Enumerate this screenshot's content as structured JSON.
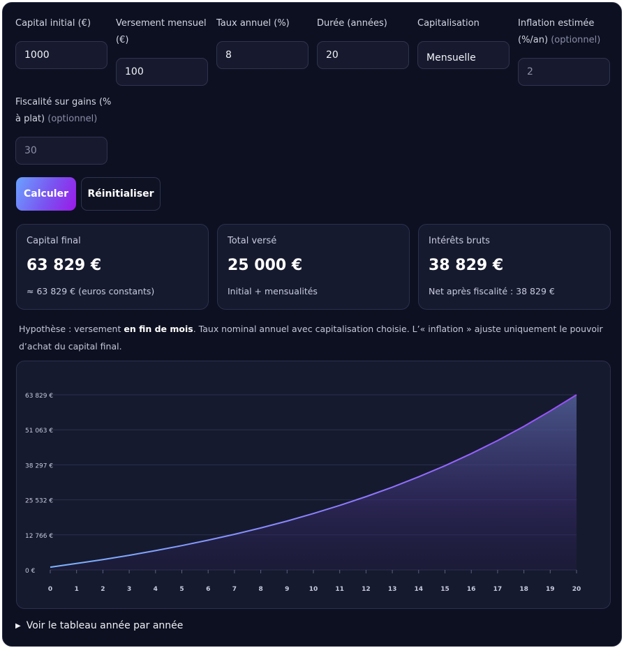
{
  "form": {
    "capital_initial": {
      "label": "Capital initial (€)",
      "value": "1000"
    },
    "versement_mensuel": {
      "label_line1": "Versement mensuel",
      "label_line2": "(€)",
      "value": "100"
    },
    "taux_annuel": {
      "label": "Taux annuel (%)",
      "value": "8"
    },
    "duree": {
      "label": "Durée (années)",
      "value": "20"
    },
    "capitalisation": {
      "label": "Capitalisation",
      "value": "Mensuelle"
    },
    "inflation": {
      "label_line1": "Inflation estimée",
      "label_line2": "(%/an)",
      "optional": "(optionnel)",
      "placeholder": "2"
    },
    "fiscalite": {
      "label_line1": "Fiscalité sur gains (%",
      "label_line2": "à plat)",
      "optional": "(optionnel)",
      "placeholder": "30"
    }
  },
  "buttons": {
    "calculer": "Calculer",
    "reinitialiser": "Réinitialiser"
  },
  "cards": [
    {
      "title": "Capital final",
      "value": "63 829 €",
      "sub": "≈ 63 829 € (euros constants)"
    },
    {
      "title": "Total versé",
      "value": "25 000 €",
      "sub": "Initial + mensualités"
    },
    {
      "title": "Intérêts bruts",
      "value": "38 829 €",
      "sub": "Net après fiscalité : 38 829 €"
    }
  ],
  "note": {
    "part1": "Hypothèse : versement ",
    "bold": "en fin de mois",
    "part2": ". Taux nominal annuel avec capitalisation choisie. L’« inflation » ajuste uniquement le pouvoir d’achat du capital final."
  },
  "colors": {
    "line_start": "#7cb6ff",
    "line_end": "#9b4dff",
    "grid": "#2c3150"
  },
  "chart_data": {
    "type": "area",
    "x": [
      0,
      1,
      2,
      3,
      4,
      5,
      6,
      7,
      8,
      9,
      10,
      11,
      12,
      13,
      14,
      15,
      16,
      17,
      18,
      19,
      20
    ],
    "y_tick_labels": [
      "0 €",
      "12 766 €",
      "25 532 €",
      "38 297 €",
      "51 063 €",
      "63 829 €"
    ],
    "y_ticks": [
      0,
      12766,
      25532,
      38297,
      51063,
      63829
    ],
    "ylim": [
      0,
      63829
    ],
    "series": [
      {
        "values": [
          1000,
          2328,
          3766,
          5325,
          7012,
          8841,
          10821,
          12967,
          15291,
          17808,
          20536,
          23490,
          26690,
          30157,
          33912,
          37978,
          42383,
          47154,
          52322,
          57919,
          63829
        ]
      }
    ],
    "grid": true
  },
  "details": {
    "summary": "Voir le tableau année par année"
  }
}
